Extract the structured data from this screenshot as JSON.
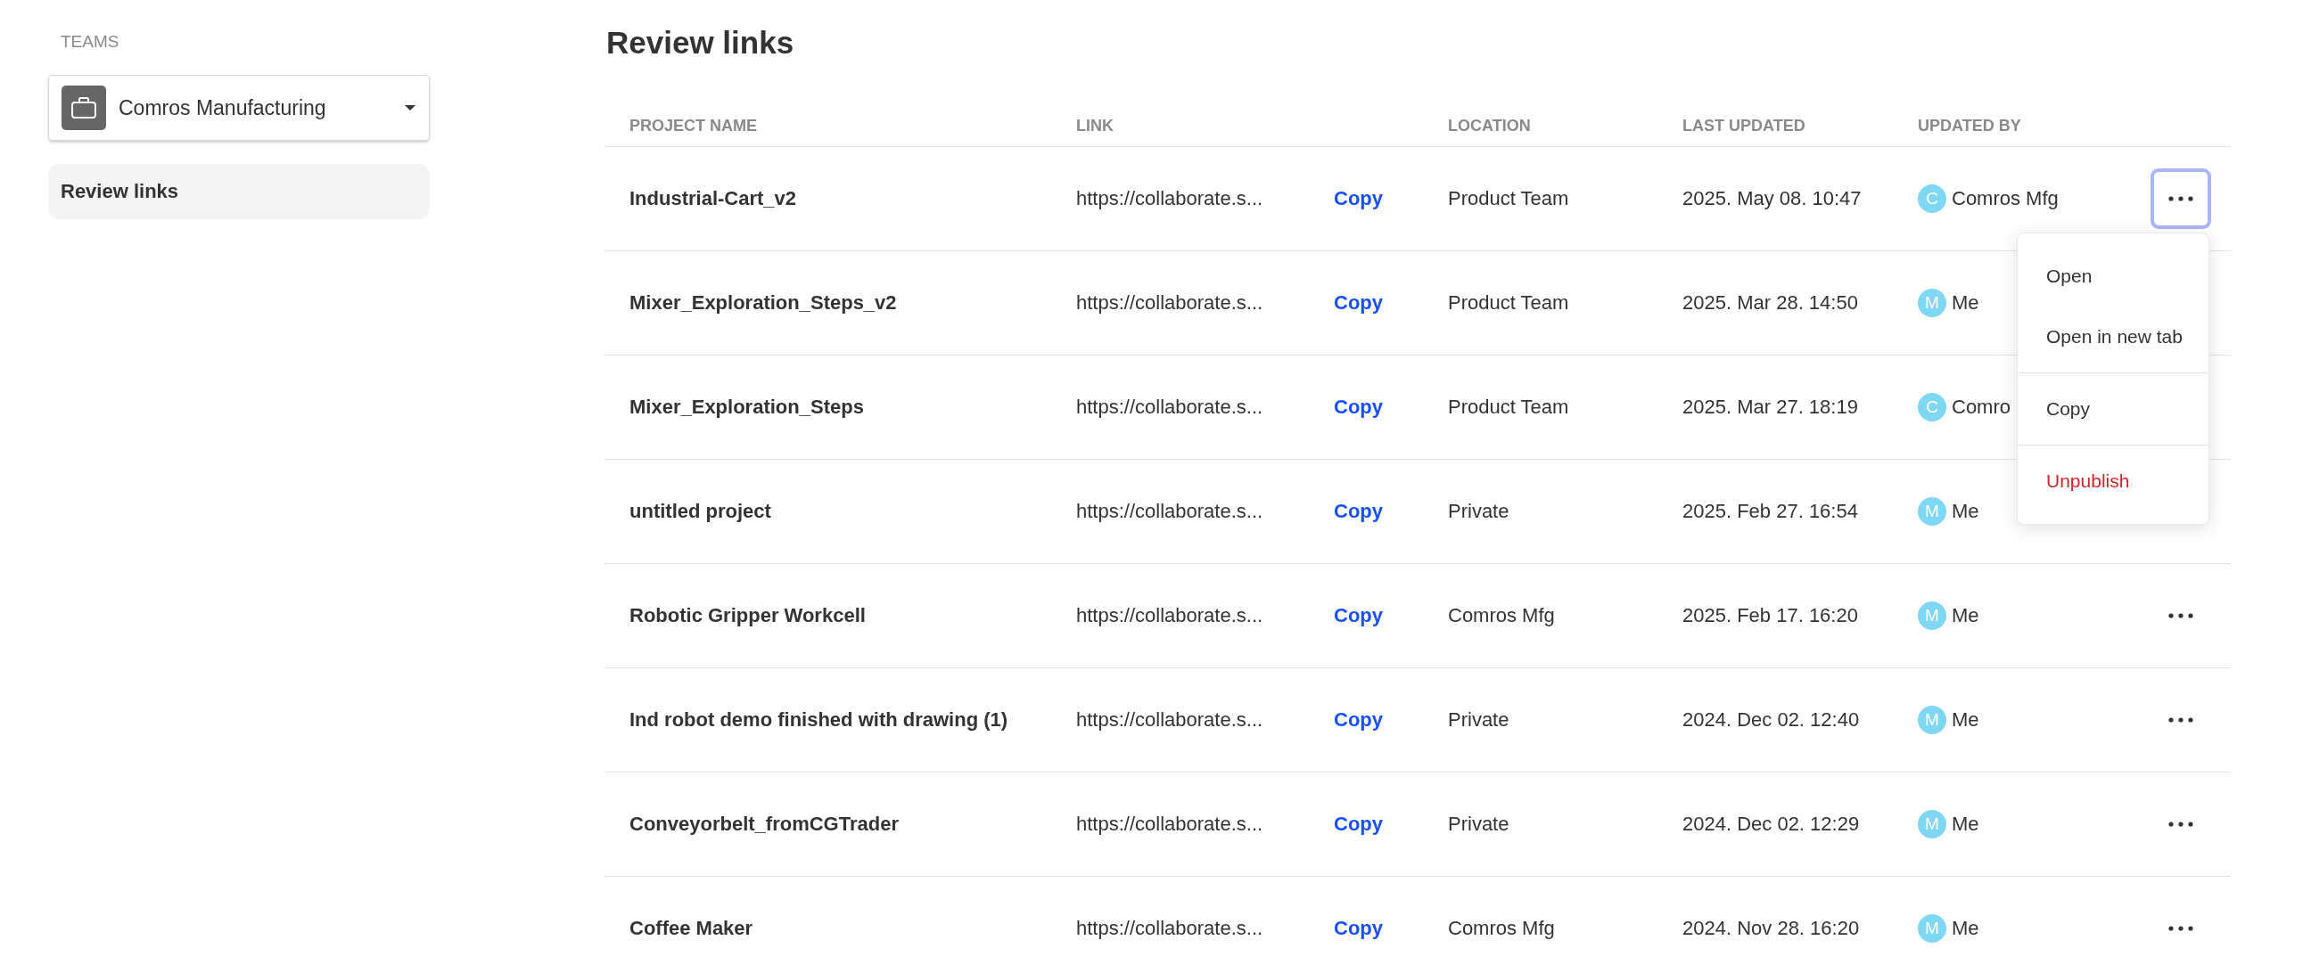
{
  "sidebar": {
    "section_label": "TEAMS",
    "team_selector": {
      "value": "Comros Manufacturing"
    },
    "items": [
      {
        "label": "Review links",
        "selected": true
      }
    ]
  },
  "page_title": "Review links",
  "table": {
    "columns": [
      "PROJECT NAME",
      "LINK",
      "LOCATION",
      "LAST UPDATED",
      "UPDATED BY"
    ],
    "rows": [
      {
        "project": "Industrial-Cart_v2",
        "link": "https://collaborate.s...",
        "copy": "Copy",
        "location": "Product Team",
        "last_updated": "2025. May 08. 10:47",
        "updated_by": {
          "initial": "C",
          "name": "Comros Mfg"
        },
        "actions": {
          "focused": true,
          "menu_open": true
        }
      },
      {
        "project": "Mixer_Exploration_Steps_v2",
        "link": "https://collaborate.s...",
        "copy": "Copy",
        "location": "Product Team",
        "last_updated": "2025. Mar 28. 14:50",
        "updated_by": {
          "initial": "M",
          "name": "Me"
        }
      },
      {
        "project": "Mixer_Exploration_Steps",
        "link": "https://collaborate.s...",
        "copy": "Copy",
        "location": "Product Team",
        "last_updated": "2025. Mar 27. 18:19",
        "updated_by": {
          "initial": "C",
          "name": "Comro"
        }
      },
      {
        "project": "untitled project",
        "link": "https://collaborate.s...",
        "copy": "Copy",
        "location": "Private",
        "last_updated": "2025. Feb 27. 16:54",
        "updated_by": {
          "initial": "M",
          "name": "Me"
        }
      },
      {
        "project": "Robotic Gripper Workcell",
        "link": "https://collaborate.s...",
        "copy": "Copy",
        "location": "Comros Mfg",
        "last_updated": "2025. Feb 17. 16:20",
        "updated_by": {
          "initial": "M",
          "name": "Me"
        },
        "actions": {
          "focused": false
        }
      },
      {
        "project": "Ind robot demo finished with drawing (1)",
        "link": "https://collaborate.s...",
        "copy": "Copy",
        "location": "Private",
        "last_updated": "2024. Dec 02. 12:40",
        "updated_by": {
          "initial": "M",
          "name": "Me"
        },
        "actions": {
          "focused": false
        }
      },
      {
        "project": "Conveyorbelt_fromCGTrader",
        "link": "https://collaborate.s...",
        "copy": "Copy",
        "location": "Private",
        "last_updated": "2024. Dec 02. 12:29",
        "updated_by": {
          "initial": "M",
          "name": "Me"
        },
        "actions": {
          "focused": false
        }
      },
      {
        "project": "Coffee Maker",
        "link": "https://collaborate.s...",
        "copy": "Copy",
        "location": "Comros Mfg",
        "last_updated": "2024. Nov 28. 16:20",
        "updated_by": {
          "initial": "M",
          "name": "Me"
        },
        "actions": {
          "focused": false
        }
      }
    ]
  },
  "context_menu": {
    "groups": [
      [
        {
          "label": "Open",
          "kind": "normal"
        },
        {
          "label": "Open in new tab",
          "kind": "normal"
        }
      ],
      [
        {
          "label": "Copy",
          "kind": "normal"
        }
      ],
      [
        {
          "label": "Unpublish",
          "kind": "danger"
        }
      ]
    ]
  }
}
